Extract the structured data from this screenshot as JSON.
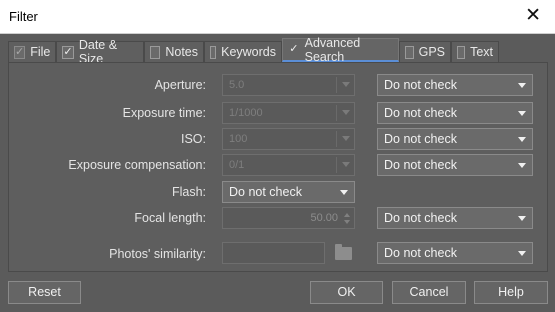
{
  "window": {
    "title": "Filter",
    "close_glyph": "✕"
  },
  "tabs": [
    {
      "label": "File",
      "checked": true,
      "check_glyph": "✓"
    },
    {
      "label": "Date & Size",
      "checked": true,
      "check_glyph": "✓"
    },
    {
      "label": "Notes",
      "checked": false,
      "check_glyph": ""
    },
    {
      "label": "Keywords",
      "checked": false,
      "check_glyph": ""
    },
    {
      "label": "Advanced Search",
      "checked": true,
      "check_glyph": "✓",
      "active": true
    },
    {
      "label": "GPS",
      "checked": false,
      "check_glyph": ""
    },
    {
      "label": "Text",
      "checked": false,
      "check_glyph": ""
    }
  ],
  "fields": {
    "aperture": {
      "label": "Aperture:",
      "value": "5.0",
      "check": "Do not check"
    },
    "exposure_time": {
      "label": "Exposure time:",
      "value": "1/1000",
      "check": "Do not check"
    },
    "iso": {
      "label": "ISO:",
      "value": "100",
      "check": "Do not check"
    },
    "exposure_comp": {
      "label": "Exposure compensation:",
      "value": "0/1",
      "check": "Do not check"
    },
    "flash": {
      "label": "Flash:",
      "value": "Do not check"
    },
    "focal_length": {
      "label": "Focal length:",
      "value": "50.00",
      "check": "Do not check"
    },
    "similarity": {
      "label": "Photos' similarity:",
      "value": "",
      "check": "Do not check"
    }
  },
  "buttons": {
    "reset": "Reset",
    "ok": "OK",
    "cancel": "Cancel",
    "help": "Help"
  },
  "colors": {
    "accent": "#5b8ed6",
    "background": "#5b5b5b"
  }
}
